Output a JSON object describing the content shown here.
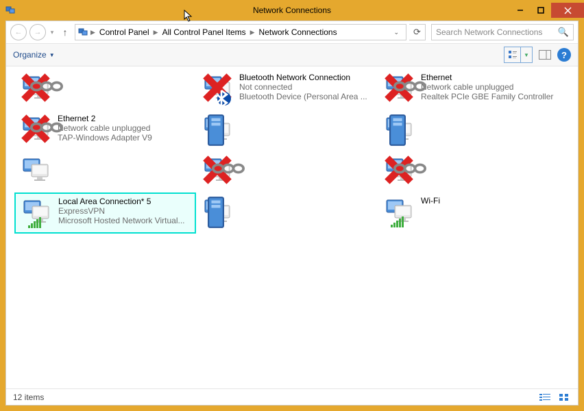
{
  "window": {
    "title": "Network Connections",
    "min": "—",
    "max": "▢",
    "close": "✕"
  },
  "address": {
    "crumbs": [
      "Control Panel",
      "All Control Panel Items",
      "Network Connections"
    ],
    "search_placeholder": "Search Network Connections"
  },
  "toolbar": {
    "organize": "Organize"
  },
  "status": {
    "count_label": "12 items"
  },
  "items": [
    {
      "name": "",
      "sub1": "",
      "sub2": "",
      "overlay": "x-chain",
      "col": 0,
      "row": 0
    },
    {
      "name": "Bluetooth Network Connection",
      "sub1": "Not connected",
      "sub2": "Bluetooth Device (Personal Area ...",
      "overlay": "x-bt",
      "col": 1,
      "row": 0
    },
    {
      "name": "Ethernet",
      "sub1": "Network cable unplugged",
      "sub2": "Realtek PCIe GBE Family Controller",
      "overlay": "x-chain",
      "col": 2,
      "row": 0
    },
    {
      "name": "Ethernet 2",
      "sub1": "Network cable unplugged",
      "sub2": "TAP-Windows Adapter V9",
      "overlay": "x-chain",
      "col": 0,
      "row": 1
    },
    {
      "name": "",
      "sub1": "",
      "sub2": "",
      "overlay": "tower",
      "col": 1,
      "row": 1
    },
    {
      "name": "",
      "sub1": "",
      "sub2": "",
      "overlay": "tower",
      "col": 2,
      "row": 1
    },
    {
      "name": "",
      "sub1": "",
      "sub2": "",
      "overlay": "none",
      "col": 0,
      "row": 2
    },
    {
      "name": "",
      "sub1": "",
      "sub2": "",
      "overlay": "x-chain",
      "col": 1,
      "row": 2
    },
    {
      "name": "",
      "sub1": "",
      "sub2": "",
      "overlay": "x-chain",
      "col": 2,
      "row": 2
    },
    {
      "name": "Local Area Connection* 5",
      "sub1": "ExpressVPN",
      "sub2": "Microsoft Hosted Network Virtual...",
      "overlay": "bars",
      "col": 0,
      "row": 3,
      "selected": true
    },
    {
      "name": "",
      "sub1": "",
      "sub2": "",
      "overlay": "tower",
      "col": 1,
      "row": 3
    },
    {
      "name": "Wi-Fi",
      "sub1": "",
      "sub2": "",
      "overlay": "bars",
      "col": 2,
      "row": 3
    }
  ]
}
